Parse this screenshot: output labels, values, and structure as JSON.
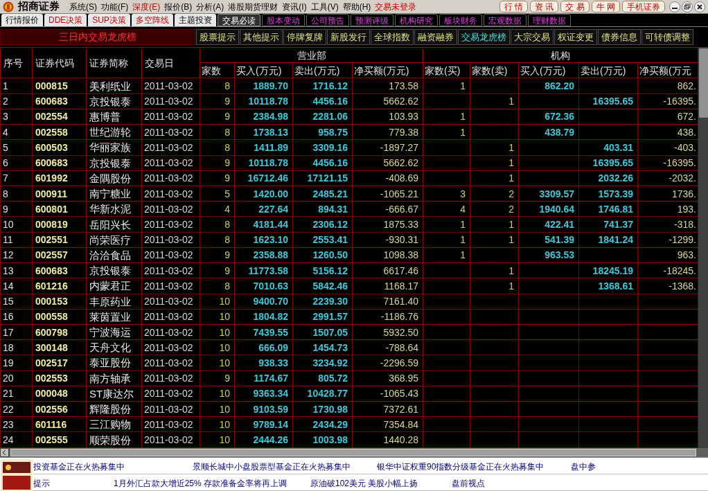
{
  "app": {
    "name": "招商证券"
  },
  "menu": [
    {
      "label": "系统(S)",
      "highlight": false
    },
    {
      "label": "功能(F)",
      "highlight": false
    },
    {
      "label": "深度(E)",
      "highlight": true
    },
    {
      "label": "报价(B)",
      "highlight": false
    },
    {
      "label": "分析(A)",
      "highlight": false
    },
    {
      "label": "港股期货理财",
      "highlight": false
    },
    {
      "label": "资讯(I)",
      "highlight": false
    },
    {
      "label": "工具(V)",
      "highlight": false
    },
    {
      "label": "帮助(H)",
      "highlight": false
    },
    {
      "label": "交易未登录",
      "highlight": true
    }
  ],
  "quick_buttons": [
    "行 情",
    "资 讯",
    "交 易",
    "牛 网",
    "手机证券"
  ],
  "tabs": [
    {
      "label": "行情报价",
      "selected": false,
      "kind": "plain"
    },
    {
      "label": "DDE决策",
      "selected": false,
      "kind": "red"
    },
    {
      "label": "SUP决策",
      "selected": false,
      "kind": "red"
    },
    {
      "label": "多空阵线",
      "selected": false,
      "kind": "red"
    },
    {
      "label": "主题投资",
      "selected": false,
      "kind": "plain"
    },
    {
      "label": "交易必读",
      "selected": true,
      "kind": "plain"
    },
    {
      "label": "股本变动",
      "selected": false,
      "kind": "info"
    },
    {
      "label": "公司预告",
      "selected": false,
      "kind": "info"
    },
    {
      "label": "预测评级",
      "selected": false,
      "kind": "info"
    },
    {
      "label": "机构研究",
      "selected": false,
      "kind": "info"
    },
    {
      "label": "板块财务",
      "selected": false,
      "kind": "info"
    },
    {
      "label": "宏观数据",
      "selected": false,
      "kind": "info"
    },
    {
      "label": "理财数据",
      "selected": false,
      "kind": "info"
    }
  ],
  "panel_title": "三日内交易龙虎榜",
  "sub_tabs": [
    {
      "label": "股票提示",
      "selected": false
    },
    {
      "label": "其他提示",
      "selected": false
    },
    {
      "label": "停牌复牌",
      "selected": false
    },
    {
      "label": "新股发行",
      "selected": false
    },
    {
      "label": "全球指数",
      "selected": false
    },
    {
      "label": "融资融券",
      "selected": false
    },
    {
      "label": "交易龙虎榜",
      "selected": true
    },
    {
      "label": "大宗交易",
      "selected": false
    },
    {
      "label": "权证变更",
      "selected": false
    },
    {
      "label": "债券信息",
      "selected": false
    },
    {
      "label": "可转债调整",
      "selected": false
    }
  ],
  "table": {
    "columns": [
      "序号",
      "证券代码",
      "证券简称",
      "交易日"
    ],
    "groups": [
      {
        "label": "营业部",
        "columns": [
          "家数",
          "买入(万元)",
          "卖出(万元)",
          "净买额(万元)"
        ]
      },
      {
        "label": "机构",
        "columns": [
          "家数(买)",
          "家数(卖)",
          "买入(万元)",
          "卖出(万元)",
          "净买额(万元"
        ]
      }
    ],
    "rows": [
      {
        "no": "1",
        "code": "000815",
        "name": "美利纸业",
        "date": "2011-03-02",
        "dept_count": "8",
        "dept_buy": "1889.70",
        "dept_sell": "1716.12",
        "dept_net": "173.58",
        "inst_buy_count": "1",
        "inst_buy": "862.20",
        "inst_net": "862."
      },
      {
        "no": "2",
        "code": "600683",
        "name": "京投银泰",
        "date": "2011-03-02",
        "dept_count": "9",
        "dept_buy": "10118.78",
        "dept_sell": "4456.16",
        "dept_net": "5662.62",
        "inst_sell_count": "1",
        "inst_sell": "16395.65",
        "inst_net": "-16395."
      },
      {
        "no": "3",
        "code": "002554",
        "name": "惠博普",
        "date": "2011-03-02",
        "dept_count": "9",
        "dept_buy": "2384.98",
        "dept_sell": "2281.06",
        "dept_net": "103.93",
        "inst_buy_count": "1",
        "inst_buy": "672.36",
        "inst_net": "672."
      },
      {
        "no": "4",
        "code": "002558",
        "name": "世纪游轮",
        "date": "2011-03-02",
        "dept_count": "8",
        "dept_buy": "1738.13",
        "dept_sell": "958.75",
        "dept_net": "779.38",
        "inst_buy_count": "1",
        "inst_buy": "438.79",
        "inst_net": "438."
      },
      {
        "no": "5",
        "code": "600503",
        "name": "华丽家族",
        "date": "2011-03-02",
        "dept_count": "8",
        "dept_buy": "1411.89",
        "dept_sell": "3309.16",
        "dept_net": "-1897.27",
        "inst_sell_count": "1",
        "inst_sell": "403.31",
        "inst_net": "-403."
      },
      {
        "no": "6",
        "code": "600683",
        "name": "京投银泰",
        "date": "2011-03-02",
        "dept_count": "9",
        "dept_buy": "10118.78",
        "dept_sell": "4456.16",
        "dept_net": "5662.62",
        "inst_sell_count": "1",
        "inst_sell": "16395.65",
        "inst_net": "-16395."
      },
      {
        "no": "7",
        "code": "601992",
        "name": "金隅股份",
        "date": "2011-03-02",
        "dept_count": "9",
        "dept_buy": "16712.46",
        "dept_sell": "17121.15",
        "dept_net": "-408.69",
        "inst_sell_count": "1",
        "inst_sell": "2032.26",
        "inst_net": "-2032."
      },
      {
        "no": "8",
        "code": "000911",
        "name": "南宁糖业",
        "date": "2011-03-02",
        "dept_count": "5",
        "dept_buy": "1420.00",
        "dept_sell": "2485.21",
        "dept_net": "-1065.21",
        "inst_buy_count": "3",
        "inst_sell_count": "2",
        "inst_buy": "3309.57",
        "inst_sell": "1573.39",
        "inst_net": "1736."
      },
      {
        "no": "9",
        "code": "600801",
        "name": "华新水泥",
        "date": "2011-03-02",
        "dept_count": "4",
        "dept_buy": "227.64",
        "dept_sell": "894.31",
        "dept_net": "-666.67",
        "inst_buy_count": "4",
        "inst_sell_count": "2",
        "inst_buy": "1940.64",
        "inst_sell": "1746.81",
        "inst_net": "193."
      },
      {
        "no": "10",
        "code": "000819",
        "name": "岳阳兴长",
        "date": "2011-03-02",
        "dept_count": "8",
        "dept_buy": "4181.44",
        "dept_sell": "2306.12",
        "dept_net": "1875.33",
        "inst_buy_count": "1",
        "inst_sell_count": "1",
        "inst_buy": "422.41",
        "inst_sell": "741.37",
        "inst_net": "-318."
      },
      {
        "no": "11",
        "code": "002551",
        "name": "尚荣医疗",
        "date": "2011-03-02",
        "dept_count": "8",
        "dept_buy": "1623.10",
        "dept_sell": "2553.41",
        "dept_net": "-930.31",
        "inst_buy_count": "1",
        "inst_sell_count": "1",
        "inst_buy": "541.39",
        "inst_sell": "1841.24",
        "inst_net": "-1299."
      },
      {
        "no": "12",
        "code": "002557",
        "name": "洽洽食品",
        "date": "2011-03-02",
        "dept_count": "9",
        "dept_buy": "2358.88",
        "dept_sell": "1260.50",
        "dept_net": "1098.38",
        "inst_buy_count": "1",
        "inst_buy": "963.53",
        "inst_net": "963."
      },
      {
        "no": "13",
        "code": "600683",
        "name": "京投银泰",
        "date": "2011-03-02",
        "dept_count": "9",
        "dept_buy": "11773.58",
        "dept_sell": "5156.12",
        "dept_net": "6617.46",
        "inst_sell_count": "1",
        "inst_sell": "18245.19",
        "inst_net": "-18245."
      },
      {
        "no": "14",
        "code": "601216",
        "name": "内蒙君正",
        "date": "2011-03-02",
        "dept_count": "8",
        "dept_buy": "7010.63",
        "dept_sell": "5842.46",
        "dept_net": "1168.17",
        "inst_sell_count": "1",
        "inst_sell": "1368.61",
        "inst_net": "-1368."
      },
      {
        "no": "15",
        "code": "000153",
        "name": "丰原药业",
        "date": "2011-03-02",
        "dept_count": "10",
        "dept_buy": "9400.70",
        "dept_sell": "2239.30",
        "dept_net": "7161.40"
      },
      {
        "no": "16",
        "code": "000558",
        "name": "莱茵置业",
        "date": "2011-03-02",
        "dept_count": "10",
        "dept_buy": "1804.82",
        "dept_sell": "2991.57",
        "dept_net": "-1186.76"
      },
      {
        "no": "17",
        "code": "600798",
        "name": "宁波海运",
        "date": "2011-03-02",
        "dept_count": "10",
        "dept_buy": "7439.55",
        "dept_sell": "1507.05",
        "dept_net": "5932.50"
      },
      {
        "no": "18",
        "code": "300148",
        "name": "天舟文化",
        "date": "2011-03-02",
        "dept_count": "10",
        "dept_buy": "666.09",
        "dept_sell": "1454.73",
        "dept_net": "-788.64"
      },
      {
        "no": "19",
        "code": "002517",
        "name": "泰亚股份",
        "date": "2011-03-02",
        "dept_count": "10",
        "dept_buy": "938.33",
        "dept_sell": "3234.92",
        "dept_net": "-2296.59"
      },
      {
        "no": "20",
        "code": "002553",
        "name": "南方轴承",
        "date": "2011-03-02",
        "dept_count": "9",
        "dept_buy": "1174.67",
        "dept_sell": "805.72",
        "dept_net": "368.95"
      },
      {
        "no": "21",
        "code": "000048",
        "name": "ST康达尔",
        "date": "2011-03-02",
        "dept_count": "10",
        "dept_buy": "9363.34",
        "dept_sell": "10428.77",
        "dept_net": "-1065.43"
      },
      {
        "no": "22",
        "code": "002556",
        "name": "辉隆股份",
        "date": "2011-03-02",
        "dept_count": "10",
        "dept_buy": "9103.59",
        "dept_sell": "1730.98",
        "dept_net": "7372.61"
      },
      {
        "no": "23",
        "code": "601116",
        "name": "三江购物",
        "date": "2011-03-02",
        "dept_count": "10",
        "dept_buy": "9789.14",
        "dept_sell": "2434.29",
        "dept_net": "7354.84"
      },
      {
        "no": "24",
        "code": "002555",
        "name": "顺荣股份",
        "date": "2011-03-02",
        "dept_count": "10",
        "dept_buy": "2444.26",
        "dept_sell": "1003.98",
        "dept_net": "1440.28"
      }
    ]
  },
  "ticker_lines": [
    [
      "投资基金正在火热募集中",
      "景顺长城中小盘股票型基金正在火热募集中",
      "银华中证权重90指数分级基金正在火热募集中",
      "盘中参"
    ],
    [
      "提示",
      "1月外汇占款大增近25% 存款准备金率将再上调",
      "原油破102美元 美股小幅上扬",
      "盘前视点"
    ]
  ]
}
